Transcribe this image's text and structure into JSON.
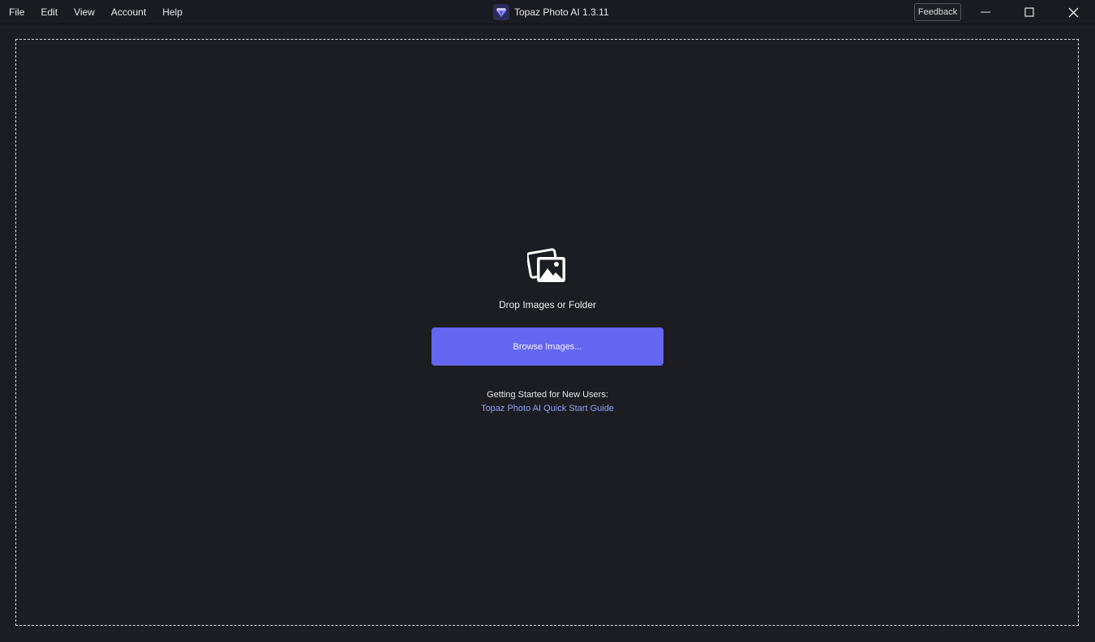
{
  "menu": {
    "items": [
      "File",
      "Edit",
      "View",
      "Account",
      "Help"
    ]
  },
  "window": {
    "title": "Topaz Photo AI 1.3.11",
    "feedback_label": "Feedback"
  },
  "dropzone": {
    "icon": "photos-icon",
    "label": "Drop Images or Folder",
    "browse_label": "Browse Images...",
    "getting_started": "Getting Started for New Users:",
    "guide_link": "Topaz Photo AI Quick Start Guide"
  },
  "colors": {
    "background": "#1c1d22",
    "accent": "#6466f1",
    "link": "#8fa2f5"
  }
}
